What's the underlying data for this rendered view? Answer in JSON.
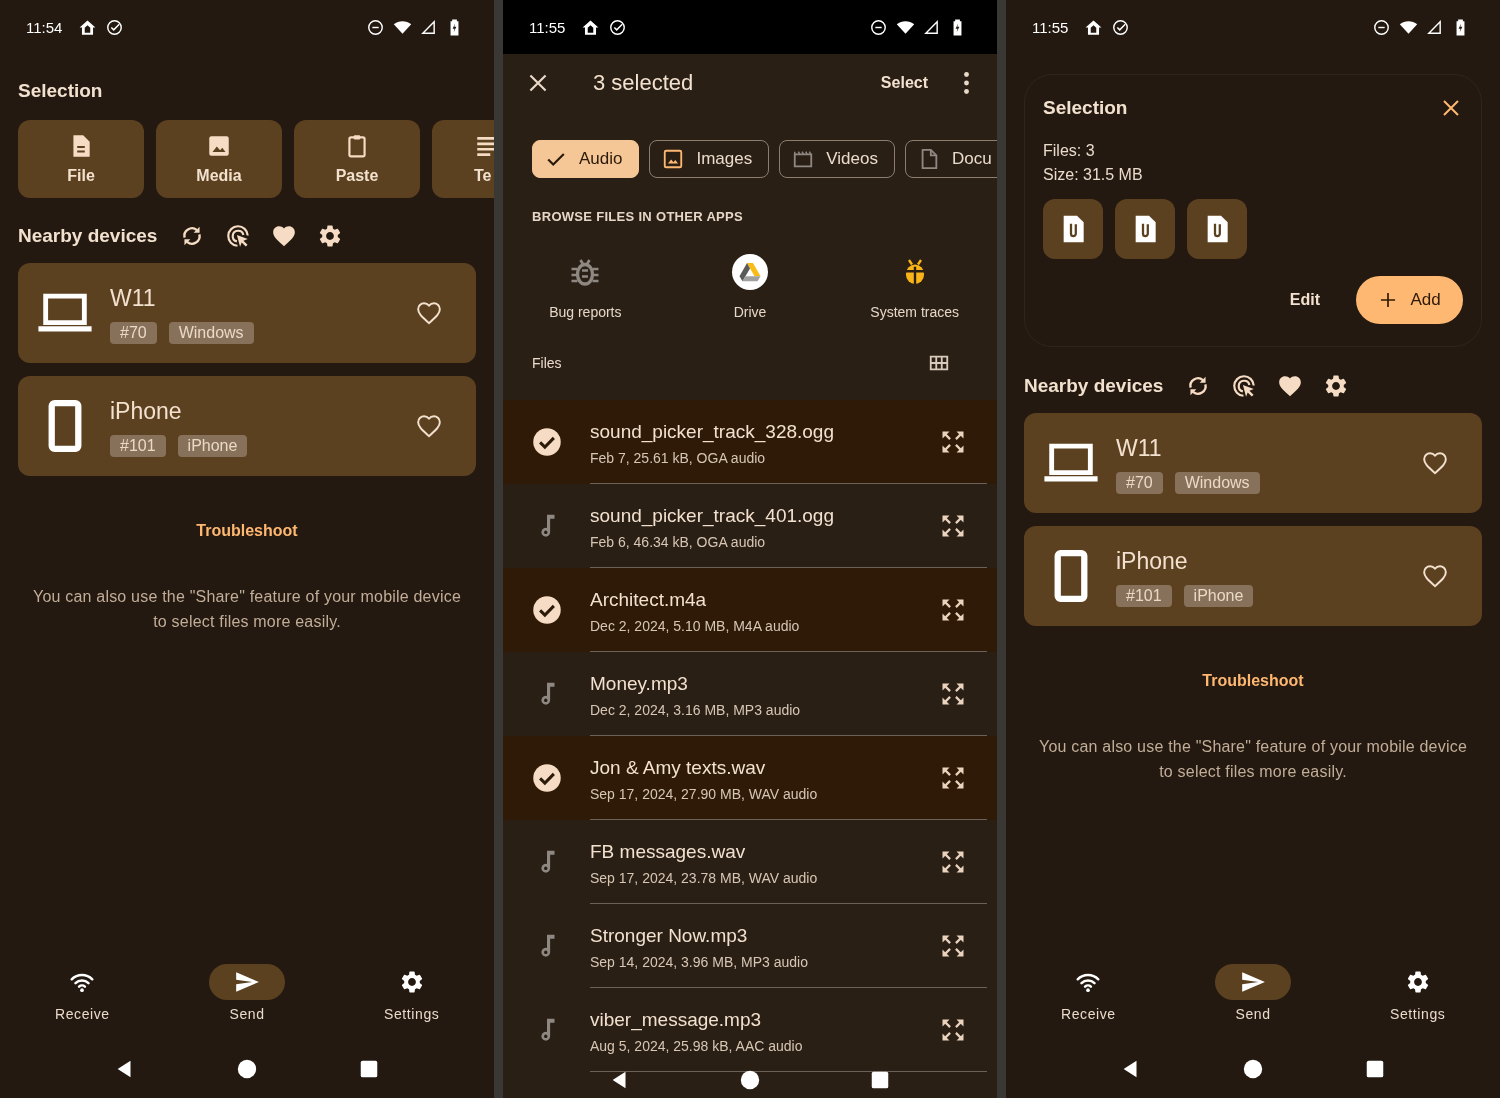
{
  "screens": [
    {
      "kind": "home",
      "status_bar": {
        "time": "11:54"
      },
      "selection": {
        "kind": "actions",
        "title": "Selection",
        "actions": [
          {
            "label": "File",
            "kind": "file"
          },
          {
            "label": "Media",
            "kind": "media"
          },
          {
            "label": "Paste",
            "kind": "paste"
          },
          {
            "label": "Te",
            "kind": "text"
          }
        ]
      },
      "nearby_title": "Nearby devices",
      "devices": [
        {
          "name": "W11",
          "kind": "laptop",
          "tags": [
            "#70",
            "Windows"
          ]
        },
        {
          "name": "iPhone",
          "kind": "phone",
          "tags": [
            "#101",
            "iPhone"
          ]
        }
      ],
      "troubleshoot": "Troubleshoot",
      "hint": "You can also use the \"Share\" feature of your mobile device to select files more easily.",
      "nav": [
        {
          "label": "Receive",
          "kind": "receive",
          "selected": false
        },
        {
          "label": "Send",
          "kind": "send",
          "selected": true
        },
        {
          "label": "Settings",
          "kind": "settings",
          "selected": false
        }
      ]
    },
    {
      "kind": "picker",
      "status_bar": {
        "time": "11:55"
      },
      "title": "3 selected",
      "action": "Select",
      "chips": [
        {
          "label": "Audio",
          "selected": true
        },
        {
          "label": "Images",
          "kind": "images",
          "selected": false
        },
        {
          "label": "Videos",
          "kind": "videos",
          "selected": false
        },
        {
          "label": "Docu",
          "kind": "documents",
          "selected": false
        }
      ],
      "browse_title": "BROWSE FILES IN OTHER APPS",
      "apps": [
        {
          "label": "Bug reports",
          "kind": "bug"
        },
        {
          "label": "Drive",
          "kind": "drive"
        },
        {
          "label": "System traces",
          "kind": "traces"
        }
      ],
      "files_title": "Files",
      "files": [
        {
          "name": "sound_picker_track_328.ogg",
          "details": "Feb 7, 25.61 kB, OGA audio",
          "selected": true
        },
        {
          "name": "sound_picker_track_401.ogg",
          "details": "Feb 6, 46.34 kB, OGA audio",
          "selected": false
        },
        {
          "name": "Architect.m4a",
          "details": "Dec 2, 2024, 5.10 MB, M4A audio",
          "selected": true
        },
        {
          "name": "Money.mp3",
          "details": "Dec 2, 2024, 3.16 MB, MP3 audio",
          "selected": false
        },
        {
          "name": "Jon & Amy texts.wav",
          "details": "Sep 17, 2024, 27.90 MB, WAV audio",
          "selected": true
        },
        {
          "name": "FB messages.wav",
          "details": "Sep 17, 2024, 23.78 MB, WAV audio",
          "selected": false
        },
        {
          "name": "Stronger Now.mp3",
          "details": "Sep 14, 2024, 3.96 MB, MP3 audio",
          "selected": false
        },
        {
          "name": "viber_message.mp3",
          "details": "Aug 5, 2024, 25.98 kB, AAC audio",
          "selected": false
        }
      ]
    },
    {
      "kind": "home",
      "status_bar": {
        "time": "11:55"
      },
      "selection": {
        "kind": "summary",
        "title": "Selection",
        "files": "Files: 3",
        "size": "Size: 31.5 MB",
        "thumbnails": [
          {
            "kind": "file"
          },
          {
            "kind": "file"
          },
          {
            "kind": "file"
          }
        ],
        "edit": "Edit",
        "add": "Add"
      },
      "nearby_title": "Nearby devices",
      "devices": [
        {
          "name": "W11",
          "kind": "laptop",
          "tags": [
            "#70",
            "Windows"
          ]
        },
        {
          "name": "iPhone",
          "kind": "phone",
          "tags": [
            "#101",
            "iPhone"
          ]
        }
      ],
      "troubleshoot": "Troubleshoot",
      "hint": "You can also use the \"Share\" feature of your mobile device to select files more easily.",
      "nav": [
        {
          "label": "Receive",
          "kind": "receive",
          "selected": false
        },
        {
          "label": "Send",
          "kind": "send",
          "selected": true
        },
        {
          "label": "Settings",
          "kind": "settings",
          "selected": false
        }
      ]
    }
  ]
}
